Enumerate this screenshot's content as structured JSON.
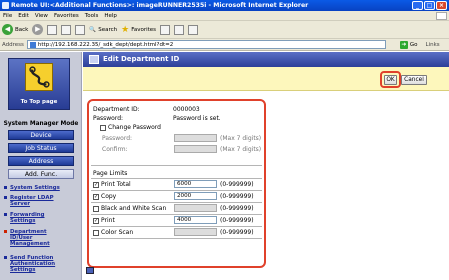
{
  "window": {
    "title": "Remote UI:<Additional Functions>: imageRUNNER2535i - Microsoft Internet Explorer",
    "buttons": [
      "_",
      "□",
      "×"
    ]
  },
  "menu": [
    "File",
    "Edit",
    "View",
    "Favorites",
    "Tools",
    "Help"
  ],
  "toolbar": {
    "back": "Back",
    "search": "Search",
    "favorites": "Favorites"
  },
  "address": {
    "label": "Address",
    "url": "http://192.168.222.35/_sdk_dept/dept.html?dt=2",
    "go": "Go",
    "links": "Links"
  },
  "sidebar": {
    "to_top": "To Top page",
    "mode_label": "System Manager Mode",
    "buttons": [
      "Device",
      "Job Status",
      "Address",
      "Add. Func."
    ],
    "links": [
      "System Settings",
      "Register LDAP Server",
      "Forwarding Settings",
      "Department ID/User Management",
      "Send Function Authentication Settings"
    ]
  },
  "header": {
    "title": "Edit Department ID"
  },
  "actions": {
    "ok": "OK",
    "cancel": "Cancel"
  },
  "form": {
    "dept_id_label": "Department ID:",
    "dept_id_value": "0000003",
    "password_label": "Password:",
    "password_value": "Password is set.",
    "change_password": "Change Password",
    "pw_field_label": "Password:",
    "pw_hint": "(Max 7 digits)",
    "confirm_label": "Confirm:",
    "confirm_hint": "(Max 7 digits)",
    "page_limits_label": "Page Limits",
    "limits": [
      {
        "label": "Print Total",
        "checked": true,
        "value": "6000",
        "range": "(0-999999)",
        "enabled": true
      },
      {
        "label": "Copy",
        "checked": true,
        "value": "2000",
        "range": "(0-999999)",
        "enabled": true
      },
      {
        "label": "Black and White Scan",
        "checked": false,
        "value": "",
        "range": "(0-999999)",
        "enabled": false
      },
      {
        "label": "Print",
        "checked": true,
        "value": "4000",
        "range": "(0-999999)",
        "enabled": true
      },
      {
        "label": "Color Scan",
        "checked": false,
        "value": "",
        "range": "(0-999999)",
        "enabled": false
      }
    ]
  }
}
